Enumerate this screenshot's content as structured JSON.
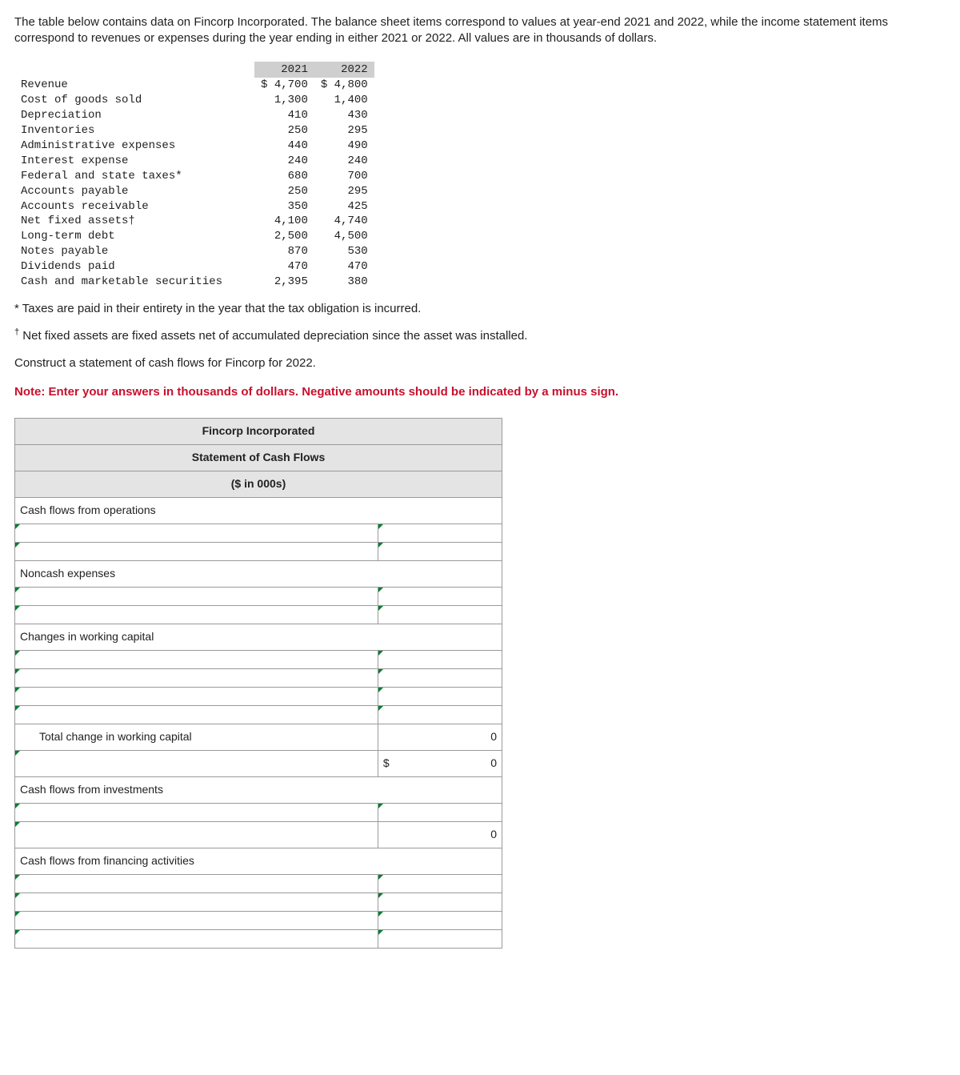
{
  "intro": "The table below contains data on Fincorp Incorporated. The balance sheet items correspond to values at year-end 2021 and 2022, while the income statement items correspond to revenues or expenses during the year ending in either 2021 or 2022. All values are in thousands of dollars.",
  "data_table": {
    "headers": [
      "",
      "2021",
      "2022"
    ],
    "rows": [
      {
        "label": "Revenue",
        "y2021": "$ 4,700",
        "y2022": "$ 4,800"
      },
      {
        "label": "Cost of goods sold",
        "y2021": "1,300",
        "y2022": "1,400"
      },
      {
        "label": "Depreciation",
        "y2021": "410",
        "y2022": "430"
      },
      {
        "label": "Inventories",
        "y2021": "250",
        "y2022": "295"
      },
      {
        "label": "Administrative expenses",
        "y2021": "440",
        "y2022": "490"
      },
      {
        "label": "Interest expense",
        "y2021": "240",
        "y2022": "240"
      },
      {
        "label": "Federal and state taxes*",
        "y2021": "680",
        "y2022": "700"
      },
      {
        "label": "Accounts payable",
        "y2021": "250",
        "y2022": "295"
      },
      {
        "label": "Accounts receivable",
        "y2021": "350",
        "y2022": "425"
      },
      {
        "label": "Net fixed assets†",
        "y2021": "4,100",
        "y2022": "4,740"
      },
      {
        "label": "Long-term debt",
        "y2021": "2,500",
        "y2022": "4,500"
      },
      {
        "label": "Notes payable",
        "y2021": "870",
        "y2022": "530"
      },
      {
        "label": "Dividends paid",
        "y2021": "470",
        "y2022": "470"
      },
      {
        "label": "Cash and marketable securities",
        "y2021": "2,395",
        "y2022": "380"
      }
    ]
  },
  "footnote1": "* Taxes are paid in their entirety in the year that the tax obligation is incurred.",
  "footnote2_prefix": "†",
  "footnote2": " Net fixed assets are fixed assets net of accumulated depreciation since the asset was installed.",
  "instruction1": "Construct a statement of cash flows for Fincorp for 2022.",
  "instruction2": "Note: Enter your answers in thousands of dollars. Negative amounts should be indicated by a minus sign.",
  "cf": {
    "title1": "Fincorp Incorporated",
    "title2": "Statement of Cash Flows",
    "title3": "($ in 000s)",
    "sec_ops": "Cash flows from operations",
    "sec_noncash": "Noncash expenses",
    "sec_wc": "Changes in working capital",
    "total_wc": "Total change in working capital",
    "currency": "$",
    "zero": "0",
    "sec_inv": "Cash flows from investments",
    "sec_fin": "Cash flows from financing activities"
  }
}
